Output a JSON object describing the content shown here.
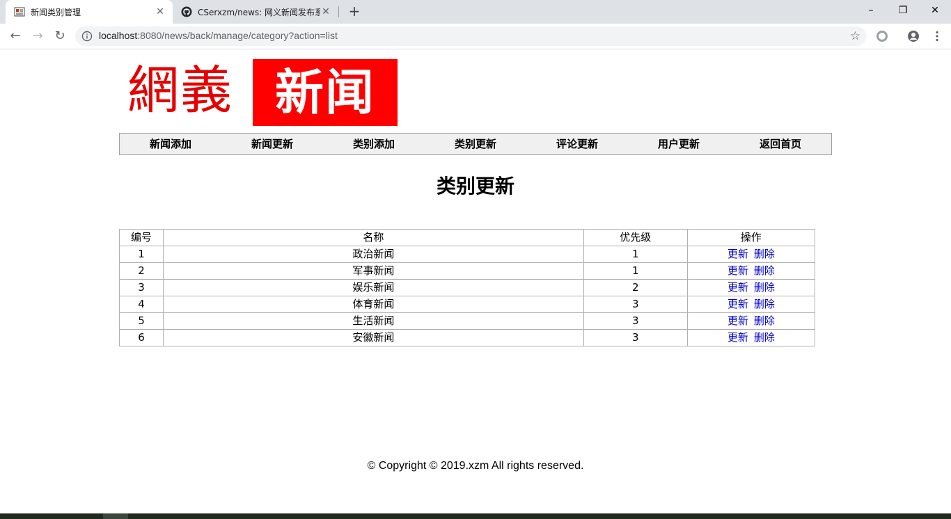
{
  "browser": {
    "tabs": [
      {
        "title": "新闻类别管理",
        "favicon": "news-favicon",
        "close": "✕"
      },
      {
        "title": "CSerxzm/news: 网义新闻发布系",
        "favicon": "github-icon",
        "close": "✕"
      }
    ],
    "new_tab": "+",
    "window_controls": {
      "minimize": "–",
      "restore": "❐",
      "close": "✕"
    },
    "nav": {
      "back": "←",
      "forward": "→",
      "reload": "↻"
    },
    "url_host": "localhost",
    "url_rest": ":8080/news/back/manage/category?action=list",
    "bookmark": "☆"
  },
  "logo": {
    "left_text": "網義",
    "right_text": "新闻"
  },
  "menu": [
    "新闻添加",
    "新闻更新",
    "类别添加",
    "类别更新",
    "评论更新",
    "用户更新",
    "返回首页"
  ],
  "page_title": "类别更新",
  "table": {
    "headers": [
      "编号",
      "名称",
      "优先级",
      "操作"
    ],
    "rows": [
      {
        "id": "1",
        "name": "政治新闻",
        "priority": "1"
      },
      {
        "id": "2",
        "name": "军事新闻",
        "priority": "1"
      },
      {
        "id": "3",
        "name": "娱乐新闻",
        "priority": "2"
      },
      {
        "id": "4",
        "name": "体育新闻",
        "priority": "3"
      },
      {
        "id": "5",
        "name": "生活新闻",
        "priority": "3"
      },
      {
        "id": "6",
        "name": "安徽新闻",
        "priority": "3"
      }
    ],
    "update_label": "更新",
    "delete_label": "删除"
  },
  "footer": "© Copyright © 2019.xzm All rights reserved.",
  "colors": {
    "link": "#0000cc",
    "logo_red": "#ff0000"
  }
}
